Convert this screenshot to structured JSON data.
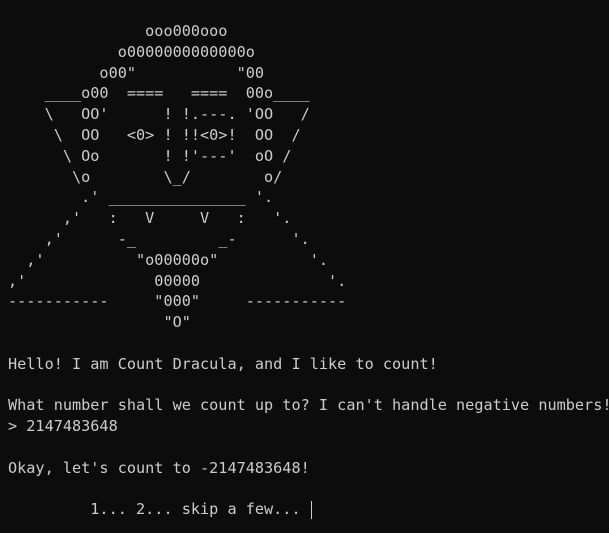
{
  "ascii_art": [
    "               ooo000ooo",
    "            o0000000000000o",
    "          o00\"           \"00",
    "    ____o00  ====   ====  00o____",
    "    \\   OO'      ! !.---. 'OO   /",
    "     \\  OO   <0> ! !!<0>!  OO  /",
    "      \\ Oo       ! !'---'  oO /",
    "       \\o        \\_/        o/",
    "        .' _______________ '.",
    "      ,'   :   V     V   :   '.",
    "    ,'      -_         _-      '.",
    "  ,'          \"o00000o\"          '.",
    ",'              00000              '.",
    "-----------     \"000\"     -----------",
    "                 \"O\""
  ],
  "greeting": "Hello! I am Count Dracula, and I like to count!",
  "prompt_question": "What number shall we count up to? I can't handle negative numbers!",
  "user_input_line": "> 2147483648",
  "response": "Okay, let's count to -2147483648!",
  "counting_line": "         1... 2... skip a few... "
}
